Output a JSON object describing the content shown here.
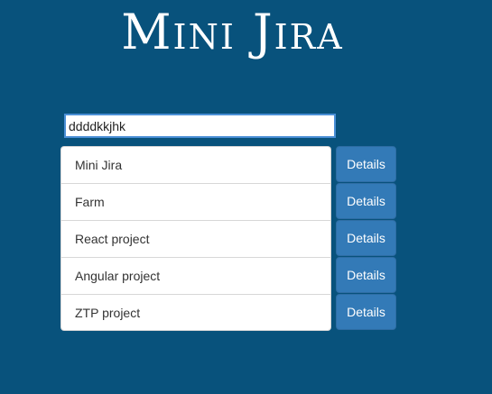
{
  "app": {
    "title": "Mini Jira"
  },
  "search": {
    "value": "ddddkkjhk"
  },
  "projects": [
    {
      "name": "Mini Jira",
      "button_label": "Details"
    },
    {
      "name": "Farm",
      "button_label": "Details"
    },
    {
      "name": "React project",
      "button_label": "Details"
    },
    {
      "name": "Angular project",
      "button_label": "Details"
    },
    {
      "name": "ZTP project",
      "button_label": "Details"
    }
  ],
  "colors": {
    "background": "#08527c",
    "button": "#337ab7",
    "input_border": "#4a8fd6"
  }
}
